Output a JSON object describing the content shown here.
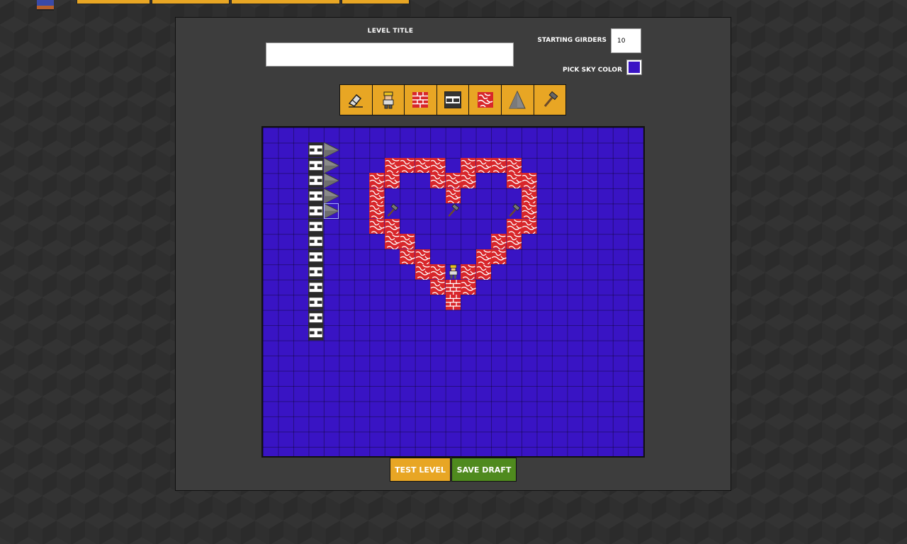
{
  "colors": {
    "sky": "#3914c4",
    "toolbar_button": "#e8a624",
    "test_button": "#e8a624",
    "save_button": "#4f8a1e",
    "panel": "#3d3d3d"
  },
  "form": {
    "level_title_label": "LEVEL TITLE",
    "level_title_value": "",
    "starting_girders_label": "STARTING GIRDERS",
    "starting_girders_value": "10",
    "sky_color_label": "PICK SKY COLOR"
  },
  "toolbar": {
    "tools": [
      {
        "icon": "eraser-icon",
        "name": "eraser"
      },
      {
        "icon": "worker-icon",
        "name": "player-start"
      },
      {
        "icon": "brick-icon",
        "name": "brick"
      },
      {
        "icon": "steel-block-icon",
        "name": "steel-block"
      },
      {
        "icon": "cracked-brick-icon",
        "name": "breakable-brick"
      },
      {
        "icon": "spike-icon",
        "name": "spike"
      },
      {
        "icon": "hammer-icon",
        "name": "hammer"
      }
    ]
  },
  "grid": {
    "columns": 25,
    "rows": 21,
    "tiles": {
      "steel": [
        [
          3,
          1
        ],
        [
          3,
          2
        ],
        [
          3,
          3
        ],
        [
          3,
          4
        ],
        [
          3,
          5
        ],
        [
          3,
          6
        ],
        [
          3,
          7
        ],
        [
          3,
          8
        ],
        [
          3,
          9
        ],
        [
          3,
          10
        ],
        [
          3,
          11
        ],
        [
          3,
          12
        ],
        [
          3,
          13
        ]
      ],
      "spike": [
        [
          4,
          1
        ],
        [
          4,
          2
        ],
        [
          4,
          3
        ],
        [
          4,
          4
        ],
        [
          4,
          5
        ]
      ],
      "selected": [
        [
          4,
          5
        ]
      ],
      "cracked": [
        [
          8,
          2
        ],
        [
          9,
          2
        ],
        [
          10,
          2
        ],
        [
          11,
          2
        ],
        [
          13,
          2
        ],
        [
          14,
          2
        ],
        [
          15,
          2
        ],
        [
          16,
          2
        ],
        [
          7,
          3
        ],
        [
          8,
          3
        ],
        [
          11,
          3
        ],
        [
          12,
          3
        ],
        [
          13,
          3
        ],
        [
          16,
          3
        ],
        [
          17,
          3
        ],
        [
          7,
          4
        ],
        [
          12,
          4
        ],
        [
          17,
          4
        ],
        [
          7,
          5
        ],
        [
          17,
          5
        ],
        [
          7,
          6
        ],
        [
          8,
          6
        ],
        [
          16,
          6
        ],
        [
          17,
          6
        ],
        [
          8,
          7
        ],
        [
          9,
          7
        ],
        [
          15,
          7
        ],
        [
          16,
          7
        ],
        [
          9,
          8
        ],
        [
          10,
          8
        ],
        [
          14,
          8
        ],
        [
          15,
          8
        ],
        [
          10,
          9
        ],
        [
          11,
          9
        ],
        [
          13,
          9
        ],
        [
          14,
          9
        ],
        [
          11,
          10
        ],
        [
          13,
          10
        ]
      ],
      "brick": [
        [
          12,
          10
        ],
        [
          12,
          11
        ]
      ],
      "hammer": [
        [
          8,
          5
        ],
        [
          12,
          5
        ],
        [
          16,
          5
        ]
      ],
      "player": [
        [
          12,
          9
        ]
      ]
    }
  },
  "buttons": {
    "test_level": "TEST LEVEL",
    "save_draft": "SAVE DRAFT"
  }
}
